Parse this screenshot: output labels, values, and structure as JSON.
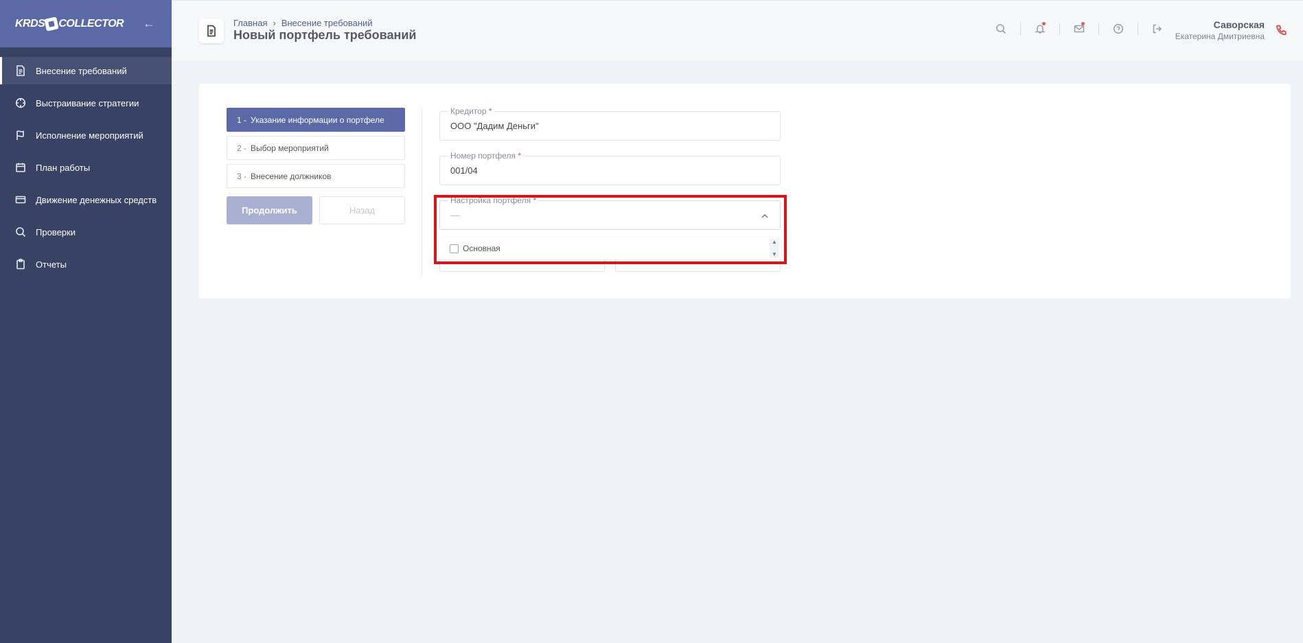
{
  "sidebar": {
    "logo_left": "KRDS",
    "logo_right": "COLLECTOR",
    "items": [
      {
        "label": "Внесение требований",
        "icon": "document-icon",
        "active": true
      },
      {
        "label": "Выстраивание стратегии",
        "icon": "crosshair-icon",
        "active": false
      },
      {
        "label": "Исполнение мероприятий",
        "icon": "flag-icon",
        "active": false
      },
      {
        "label": "План работы",
        "icon": "calendar-icon",
        "active": false
      },
      {
        "label": "Движение денежных средств",
        "icon": "credit-card-icon",
        "active": false
      },
      {
        "label": "Проверки",
        "icon": "search-icon",
        "active": false
      },
      {
        "label": "Отчеты",
        "icon": "clipboard-icon",
        "active": false
      }
    ]
  },
  "header": {
    "breadcrumb": [
      "Главная",
      "Внесение требований"
    ],
    "breadcrumb_separator": "›",
    "title": "Новый портфель требований",
    "user": {
      "last_name": "Саворская",
      "first_name": "Екатерина Дмитриевна"
    },
    "icons": [
      "search-icon",
      "bell-icon",
      "mail-icon",
      "help-icon",
      "logout-icon",
      "phone-icon"
    ]
  },
  "steps": [
    {
      "num": "1 -",
      "label": "Указание информации о портфеле",
      "active": true
    },
    {
      "num": "2 -",
      "label": "Выбор мероприятий",
      "active": false
    },
    {
      "num": "3 -",
      "label": "Внесение должников",
      "active": false
    }
  ],
  "buttons": {
    "continue": "Продолжить",
    "back": "Назад"
  },
  "form": {
    "creditor": {
      "label": "Кредитор",
      "required": "*",
      "value": "ООО \"Дадим Деньги\""
    },
    "portfolio_number": {
      "label": "Номер портфеля",
      "required": "*",
      "value": "001/04"
    },
    "portfolio_setting": {
      "label": "Настройка портфеля",
      "required": "*",
      "value": "—",
      "options": [
        "Основная"
      ]
    }
  },
  "colors": {
    "accent": "#5b6aa6",
    "sidebar": "#384265",
    "highlight": "#d7141a"
  }
}
